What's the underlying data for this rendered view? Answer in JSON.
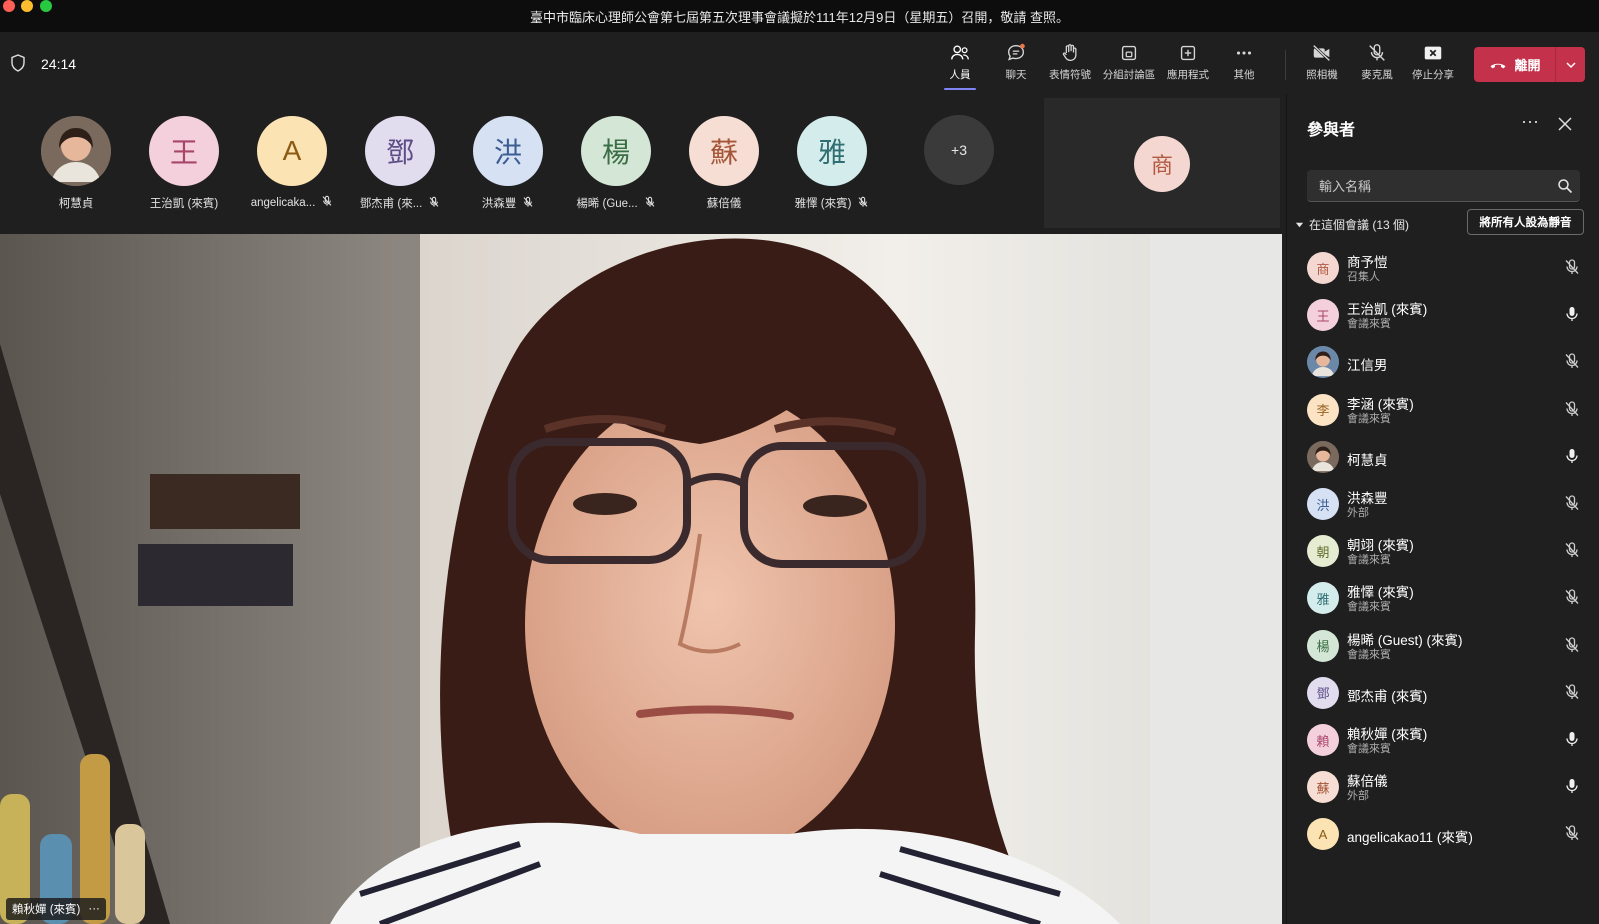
{
  "window": {
    "title": "臺中市臨床心理師公會第七屆第五次理事會議擬於111年12月9日（星期五）召開，敬請 查照。"
  },
  "toolbar": {
    "timer": "24:14",
    "buttons": {
      "people": "人員",
      "chat": "聊天",
      "reactions": "表情符號",
      "breakout": "分組討論區",
      "apps": "應用程式",
      "more": "其他",
      "camera": "照相機",
      "mic": "麥克風",
      "share": "停止分享"
    },
    "leave": "離開"
  },
  "gallery": {
    "tiles": [
      {
        "initial": "",
        "name": "柯慧貞",
        "muted": false,
        "bg": "#7a6a5e",
        "fg": "#ffffff"
      },
      {
        "initial": "王",
        "name": "王治凱 (來賓)",
        "muted": false,
        "bg": "#f4d0dc",
        "fg": "#a8466a"
      },
      {
        "initial": "A",
        "name": "angelicaka...",
        "muted": true,
        "bg": "#fbe3b3",
        "fg": "#8a5a12"
      },
      {
        "initial": "鄧",
        "name": "鄧杰甫 (來...",
        "muted": true,
        "bg": "#e2dcef",
        "fg": "#5b4f86"
      },
      {
        "initial": "洪",
        "name": "洪森豐",
        "muted": true,
        "bg": "#d6e1f3",
        "fg": "#3c5d93"
      },
      {
        "initial": "楊",
        "name": "楊晞 (Gue...",
        "muted": true,
        "bg": "#d4e6d6",
        "fg": "#3b6e45"
      },
      {
        "initial": "蘇",
        "name": "蘇倍儀",
        "muted": false,
        "bg": "#f7ded4",
        "fg": "#a45638"
      },
      {
        "initial": "雅",
        "name": "雅懌 (來賓)",
        "muted": true,
        "bg": "#d5ecec",
        "fg": "#2f6e72"
      }
    ],
    "overflow": "+3",
    "self_initial": "商"
  },
  "main_video": {
    "speaker_name": "賴秋嬋 (來賓)",
    "more": "···"
  },
  "panel": {
    "title": "參與者",
    "more": "···",
    "search_placeholder": "輸入名稱",
    "section_label": "在這個會議 (13 個)",
    "mute_all": "將所有人設為靜音",
    "participants": [
      {
        "initial": "商",
        "name": "商予愷",
        "role": "召集人",
        "mic": "off",
        "bg": "#f4d7d0",
        "fg": "#b05a43"
      },
      {
        "initial": "王",
        "name": "王治凱 (來賓)",
        "role": "會議來賓",
        "mic": "on",
        "bg": "#f4d0dc",
        "fg": "#a8466a"
      },
      {
        "initial": "",
        "name": "江信男",
        "role": "",
        "mic": "off",
        "bg": "#6b88a8",
        "fg": "#ffffff"
      },
      {
        "initial": "李",
        "name": "李涵 (來賓)",
        "role": "會議來賓",
        "mic": "off",
        "bg": "#fbe3c3",
        "fg": "#9a6224"
      },
      {
        "initial": "",
        "name": "柯慧貞",
        "role": "",
        "mic": "on",
        "bg": "#7a6a5e",
        "fg": "#ffffff"
      },
      {
        "initial": "洪",
        "name": "洪森豐",
        "role": "外部",
        "mic": "off",
        "bg": "#d6e1f3",
        "fg": "#3c5d93"
      },
      {
        "initial": "朝",
        "name": "朝翊 (來賓)",
        "role": "會議來賓",
        "mic": "off",
        "bg": "#e6ecd2",
        "fg": "#5f6e2c"
      },
      {
        "initial": "雅",
        "name": "雅懌 (來賓)",
        "role": "會議來賓",
        "mic": "off",
        "bg": "#d5ecec",
        "fg": "#2f6e72"
      },
      {
        "initial": "楊",
        "name": "楊晞 (Guest) (來賓)",
        "role": "會議來賓",
        "mic": "off",
        "bg": "#d4e6d6",
        "fg": "#3b6e45"
      },
      {
        "initial": "鄧",
        "name": "鄧杰甫 (來賓)",
        "role": "",
        "mic": "off",
        "bg": "#e2dcef",
        "fg": "#5b4f86"
      },
      {
        "initial": "賴",
        "name": "賴秋嬋 (來賓)",
        "role": "會議來賓",
        "mic": "on",
        "bg": "#f4d0dc",
        "fg": "#a8466a"
      },
      {
        "initial": "蘇",
        "name": "蘇倍儀",
        "role": "外部",
        "mic": "on",
        "bg": "#f7ded4",
        "fg": "#a45638"
      },
      {
        "initial": "A",
        "name": "angelicakao11 (來賓)",
        "role": "",
        "mic": "off",
        "bg": "#fbe3b3",
        "fg": "#8a5a12"
      }
    ]
  },
  "colors": {
    "accent": "#7f85f5",
    "leave": "#c4314b",
    "notification": "#e97548"
  }
}
